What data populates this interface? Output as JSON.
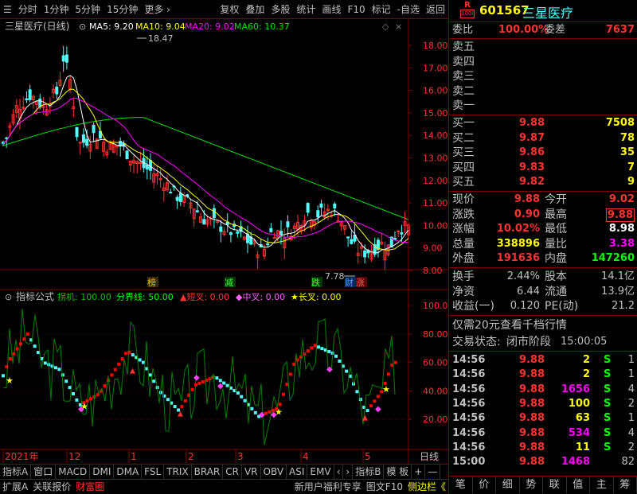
{
  "toolbar": {
    "items": [
      "分时",
      "1分钟",
      "5分钟",
      "15分钟",
      "更多 ›",
      "复权",
      "叠加",
      "多股",
      "统计",
      "画线",
      "F10",
      "标记",
      "-自选",
      "返回"
    ]
  },
  "stock": {
    "code": "601567",
    "name": "三星医疗",
    "badge_top": "R",
    "badge_bottom": "1000"
  },
  "main_chart": {
    "title": "三星医疗(日线)",
    "ma5_label": "MA5: 9.20",
    "ma10_label": "MA10: 9.04",
    "ma20_label": "MA20: 9.02",
    "ma60_label": "MA60: 10.37",
    "high_marker": "18.47",
    "low_marker": "7.78",
    "y_ticks": [
      "18.00",
      "17.00",
      "16.00",
      "15.00",
      "14.00",
      "13.00",
      "12.00",
      "11.00",
      "10.00",
      "9.00",
      "8.00"
    ],
    "event_tags": [
      "榜",
      "减",
      "跌",
      "财",
      "涨"
    ],
    "colors": {
      "up": "#ff3232",
      "down": "#54fcfc",
      "ma5": "#ffffff",
      "ma10": "#ffff00",
      "ma20": "#ff00ff",
      "ma60": "#00e000"
    }
  },
  "indicator": {
    "title": "指标公式",
    "l1": "拐机: 100.00",
    "l2": "分界线: 50.00",
    "l3": "▲短叉: 0.00",
    "l4": "◆中叉: 0.00",
    "l5": "★长叉: 0.00",
    "y_ticks": [
      "100.0",
      "80.00",
      "60.00",
      "40.00",
      "20.00"
    ]
  },
  "x_axis": {
    "labels": [
      "2021年",
      "12",
      "1",
      "2",
      "3",
      "4",
      "5"
    ],
    "right_label": "日线"
  },
  "bottom_tabs": [
    "指标A",
    "窗口",
    "MACD",
    "DMI",
    "DMA",
    "FSL",
    "TRIX",
    "BRAR",
    "CR",
    "VR",
    "OBV",
    "ASI",
    "EMV",
    "‹",
    "›",
    "指标B",
    "模 板",
    "+",
    "—"
  ],
  "status_tabs": [
    "扩展A",
    "关联报价",
    "财富圈"
  ],
  "status_right": [
    "新用户福利专享",
    "图文F10",
    "侧边栏《"
  ],
  "quote": {
    "weibi_label": "委比",
    "weibi_value": "100.00%",
    "weicha_label": "委差",
    "weicha_value": "7637",
    "sell": [
      {
        "label": "卖五"
      },
      {
        "label": "卖四"
      },
      {
        "label": "卖三"
      },
      {
        "label": "卖二"
      },
      {
        "label": "卖一"
      }
    ],
    "buy": [
      {
        "label": "买一",
        "price": "9.88",
        "vol": "7508"
      },
      {
        "label": "买二",
        "price": "9.87",
        "vol": "78"
      },
      {
        "label": "买三",
        "price": "9.86",
        "vol": "35"
      },
      {
        "label": "买四",
        "price": "9.83",
        "vol": "7"
      },
      {
        "label": "买五",
        "price": "9.82",
        "vol": "9"
      }
    ],
    "stats": [
      {
        "l1": "现价",
        "v1": "9.88",
        "l2": "今开",
        "v2": "9.02"
      },
      {
        "l1": "涨跌",
        "v1": "0.90",
        "l2": "最高",
        "v2": "9.88"
      },
      {
        "l1": "涨幅",
        "v1": "10.02%",
        "l2": "最低",
        "v2": "8.98"
      },
      {
        "l1": "总量",
        "v1": "338896",
        "l2": "量比",
        "v2": "3.38"
      },
      {
        "l1": "外盘",
        "v1": "191636",
        "l2": "内盘",
        "v2": "147260"
      }
    ],
    "stats2": [
      {
        "l1": "换手",
        "v1": "2.44%",
        "l2": "股本",
        "v2": "14.1亿"
      },
      {
        "l1": "净资",
        "v1": "6.44",
        "l2": "流通",
        "v2": "13.9亿"
      },
      {
        "l1": "收益(一)",
        "v1": "0.120",
        "l2": "PE(动)",
        "v2": "21.2"
      }
    ],
    "promo": "仅需20元查看千档行情",
    "trade_status_label": "交易状态:",
    "trade_status": "闭市阶段",
    "trade_time": "15:00:05",
    "ticks": [
      {
        "t": "14:56",
        "p": "9.88",
        "v": "2",
        "d": "S",
        "n": "1"
      },
      {
        "t": "14:56",
        "p": "9.88",
        "v": "2",
        "d": "S",
        "n": "1"
      },
      {
        "t": "14:56",
        "p": "9.88",
        "v": "1656",
        "d": "S",
        "n": "4"
      },
      {
        "t": "14:56",
        "p": "9.88",
        "v": "100",
        "d": "S",
        "n": "2"
      },
      {
        "t": "14:56",
        "p": "9.88",
        "v": "63",
        "d": "S",
        "n": "1"
      },
      {
        "t": "14:56",
        "p": "9.88",
        "v": "534",
        "d": "S",
        "n": "4"
      },
      {
        "t": "14:56",
        "p": "9.88",
        "v": "11",
        "d": "S",
        "n": "2"
      },
      {
        "t": "15:00",
        "p": "9.88",
        "v": "1468",
        "d": "",
        "n": "82"
      }
    ]
  },
  "right_tabs": [
    "笔",
    "价",
    "细",
    "势",
    "联",
    "值",
    "主",
    "筹"
  ]
}
